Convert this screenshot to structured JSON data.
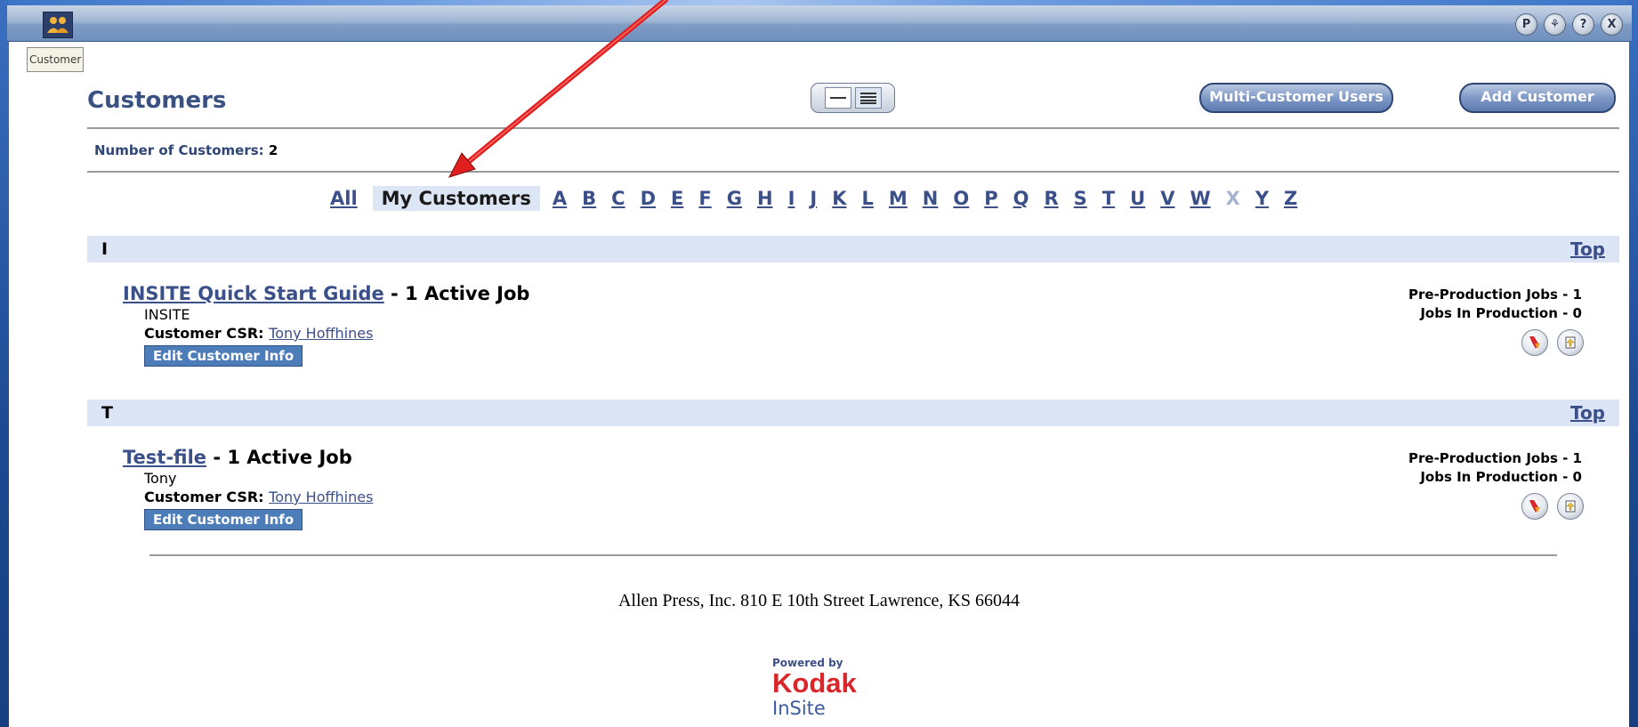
{
  "window": {
    "tooltip": "Customer",
    "top_buttons": [
      "P",
      "⚘",
      "?",
      "X"
    ]
  },
  "header": {
    "title": "Customers",
    "multi_customer_label": "Multi-Customer Users",
    "add_customer_label": "Add Customer"
  },
  "count": {
    "label": "Number of Customers:",
    "value": "2"
  },
  "alpha": {
    "all": "All",
    "my_customers": "My Customers",
    "letters": [
      "A",
      "B",
      "C",
      "D",
      "E",
      "F",
      "G",
      "H",
      "I",
      "J",
      "K",
      "L",
      "M",
      "N",
      "O",
      "P",
      "Q",
      "R",
      "S",
      "T",
      "U",
      "V",
      "W",
      "X",
      "Y",
      "Z"
    ],
    "disabled": [
      "X"
    ]
  },
  "sections": [
    {
      "letter": "I",
      "top": "Top",
      "customer": {
        "name": "INSITE Quick Start Guide",
        "jobs": " -  1 Active Job",
        "sub": "INSITE",
        "csr_label": "Customer CSR:",
        "csr_name": "Tony Hoffhines",
        "edit": "Edit Customer Info",
        "pre_production": "Pre-Production Jobs - 1",
        "in_production": "Jobs In Production - 0"
      }
    },
    {
      "letter": "T",
      "top": "Top",
      "customer": {
        "name": "Test-file",
        "jobs": " -  1 Active Job",
        "sub": "Tony",
        "csr_label": "Customer CSR:",
        "csr_name": "Tony Hoffhines",
        "edit": "Edit Customer Info",
        "pre_production": "Pre-Production Jobs - 1",
        "in_production": "Jobs In Production - 0"
      }
    }
  ],
  "footer": {
    "address": "Allen Press, Inc. 810 E 10th Street Lawrence, KS 66044",
    "powered_by": "Powered by",
    "brand": "Kodak",
    "product": "InSite"
  },
  "colors": {
    "link": "#3b4f88",
    "section_bg": "#dbe5f6",
    "annotation_arrow": "#e01f1f",
    "kodak_red": "#d9262b"
  }
}
